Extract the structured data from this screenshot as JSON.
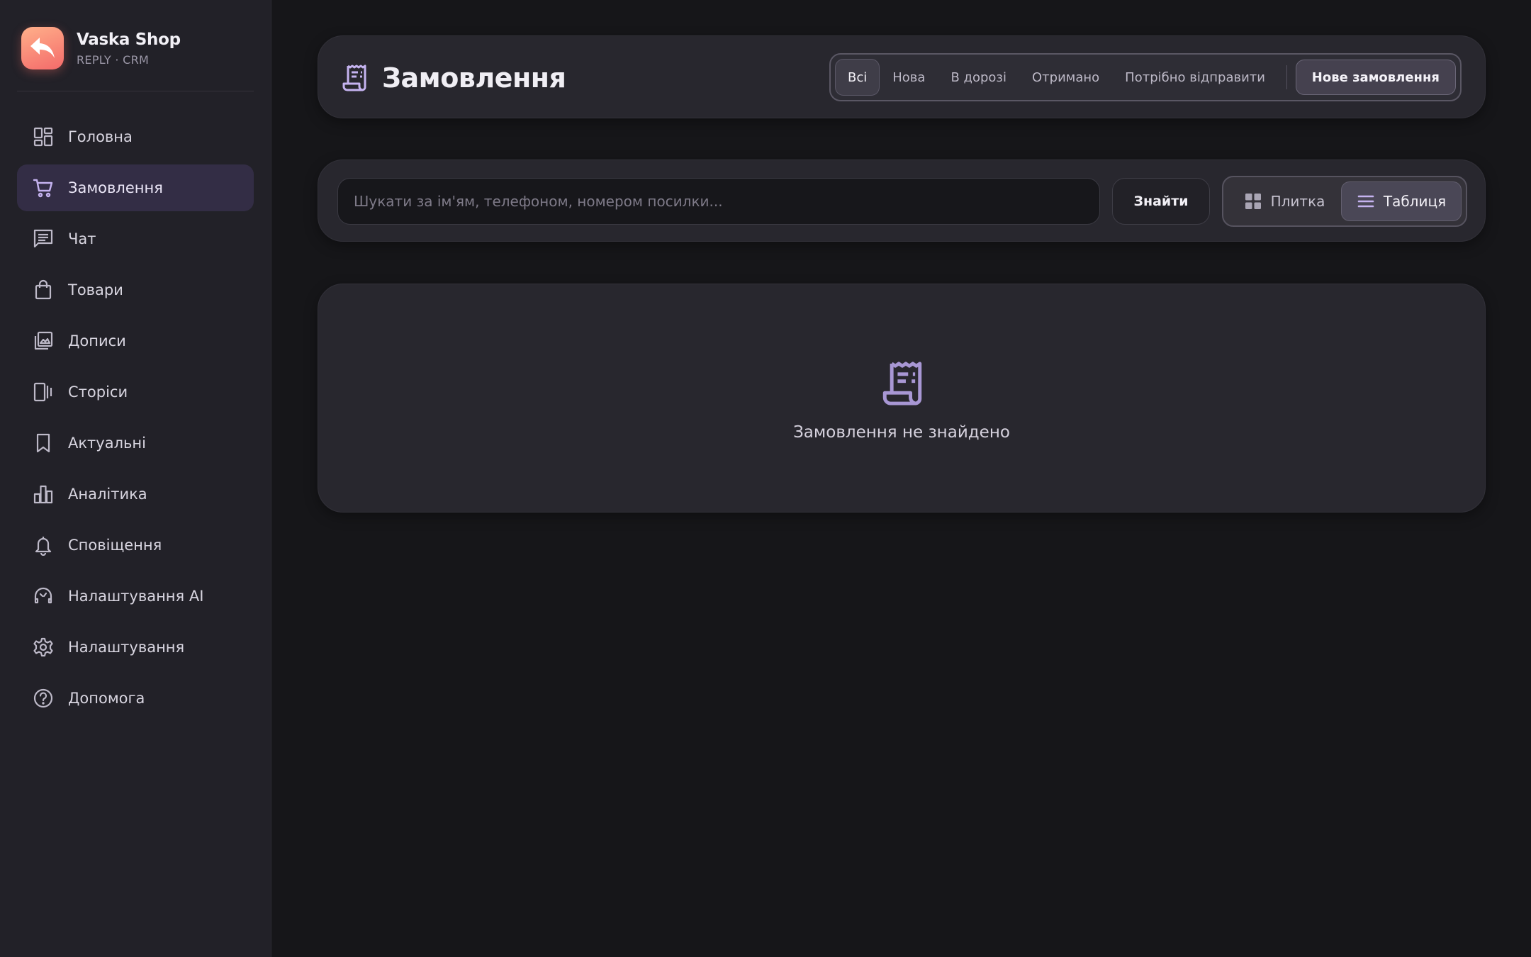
{
  "brand": {
    "name": "Vaska Shop",
    "subtitle": "REPLY · CRM"
  },
  "sidebar": {
    "items": [
      {
        "label": "Головна",
        "icon": "dashboard-icon",
        "active": false
      },
      {
        "label": "Замовлення",
        "icon": "cart-icon",
        "active": true
      },
      {
        "label": "Чат",
        "icon": "chat-icon",
        "active": false
      },
      {
        "label": "Товари",
        "icon": "shopping-bag-icon",
        "active": false
      },
      {
        "label": "Дописи",
        "icon": "gallery-icon",
        "active": false
      },
      {
        "label": "Сторіси",
        "icon": "stories-icon",
        "active": false
      },
      {
        "label": "Актуальні",
        "icon": "bookmark-icon",
        "active": false
      },
      {
        "label": "Аналітика",
        "icon": "analytics-icon",
        "active": false
      },
      {
        "label": "Сповіщення",
        "icon": "bell-icon",
        "active": false
      },
      {
        "label": "Налаштування AI",
        "icon": "ai-settings-icon",
        "active": false
      },
      {
        "label": "Налаштування",
        "icon": "gear-icon",
        "active": false
      },
      {
        "label": "Допомога",
        "icon": "help-icon",
        "active": false
      }
    ]
  },
  "header": {
    "title": "Замовлення",
    "icon": "receipt-icon",
    "filters": [
      {
        "label": "Всі",
        "active": true
      },
      {
        "label": "Нова",
        "active": false
      },
      {
        "label": "В дорозі",
        "active": false
      },
      {
        "label": "Отримано",
        "active": false
      },
      {
        "label": "Потрібно відправити",
        "active": false
      }
    ],
    "new_order_label": "Нове замовлення"
  },
  "search": {
    "placeholder": "Шукати за ім'ям, телефоном, номером посилки...",
    "value": "",
    "button_label": "Знайти"
  },
  "view_toggle": {
    "tiles_label": "Плитка",
    "table_label": "Таблиця",
    "selected": "table"
  },
  "empty_state": {
    "icon": "receipt-icon",
    "message": "Замовлення не знайдено"
  },
  "colors": {
    "accent": "#b9a6e6",
    "active_nav_bg": "#332d45",
    "logo_gradient_start": "#ffb08a",
    "logo_gradient_end": "#f46a6a"
  }
}
